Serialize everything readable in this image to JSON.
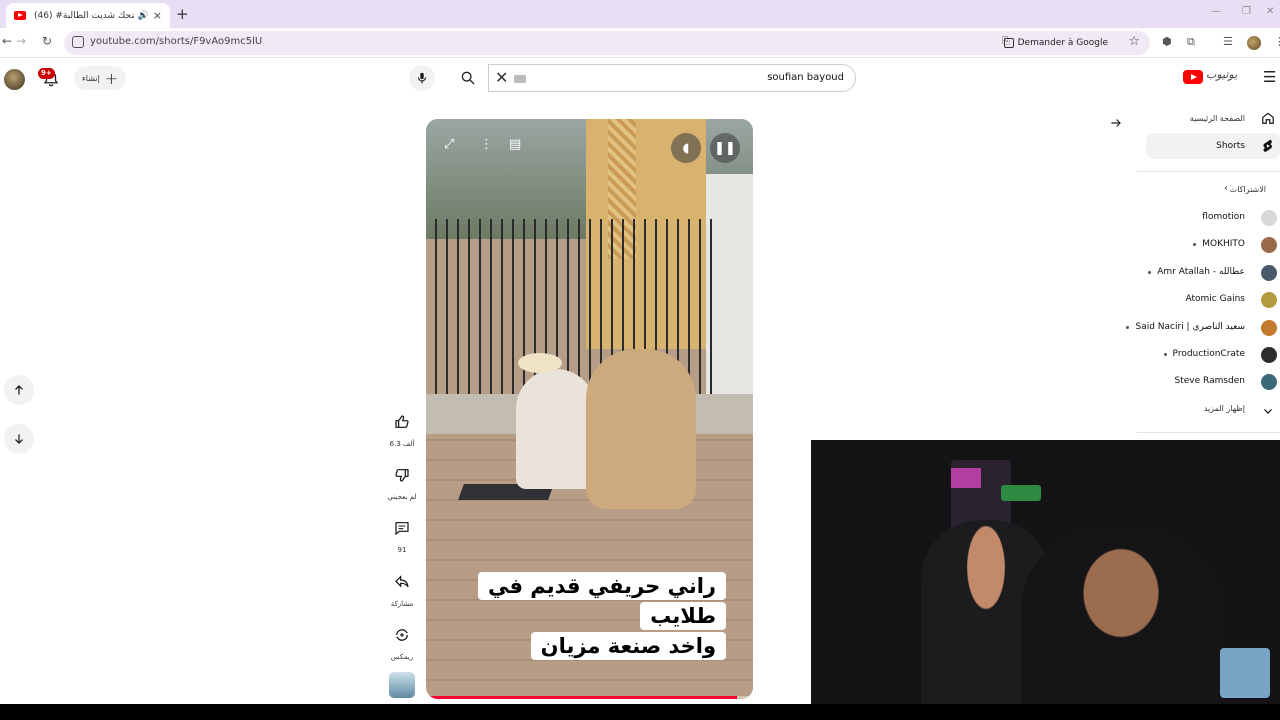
{
  "browser": {
    "tab_title": "(46) #مضحك شديت الطالبة",
    "new_tab": "+",
    "tab_close": "×",
    "url": "youtube.com/shorts/F9vAo9mc5lU",
    "google_button": "Demander à Google"
  },
  "header": {
    "notif_badge": "9+",
    "create_label": "إنشاء",
    "search_query": "soufian bayoud"
  },
  "sidebar": {
    "home_label": "الصفحة الرئيسية",
    "shorts_label": "Shorts",
    "subscriptions_label": "الاشتراكات",
    "subscriptions": [
      {
        "name": "flomotion",
        "new": false,
        "color": "#d8d8d8"
      },
      {
        "name": "MOKHITO",
        "new": true,
        "color": "#9a6a4a"
      },
      {
        "name": "Amr Atallah - عطالله",
        "new": true,
        "color": "#4a5a6a"
      },
      {
        "name": "Atomic Gains",
        "new": false,
        "color": "#b59a3e"
      },
      {
        "name": "Said Naciri | سعيد الناصري",
        "new": true,
        "color": "#c27a2e"
      },
      {
        "name": "ProductionCrate",
        "new": true,
        "color": "#2d2d2d"
      },
      {
        "name": "Steve Ramsden",
        "new": false,
        "color": "#3a6a7a"
      }
    ],
    "show_more": "إظهار المزيد"
  },
  "short": {
    "caption_line1": "راني حريفي قديم في طلايب",
    "caption_line2": "واخد صنعة مزيان",
    "progress": 0.95,
    "likes": "6.3 ألف",
    "dislike_label": "لم يعجبني",
    "comments": "91",
    "share_label": "مشاركة",
    "remix_label": "ريمكس"
  },
  "colors": {
    "accent": "#ff0000",
    "progress": "#ff0033",
    "tabstrip": "#e8dff5"
  }
}
